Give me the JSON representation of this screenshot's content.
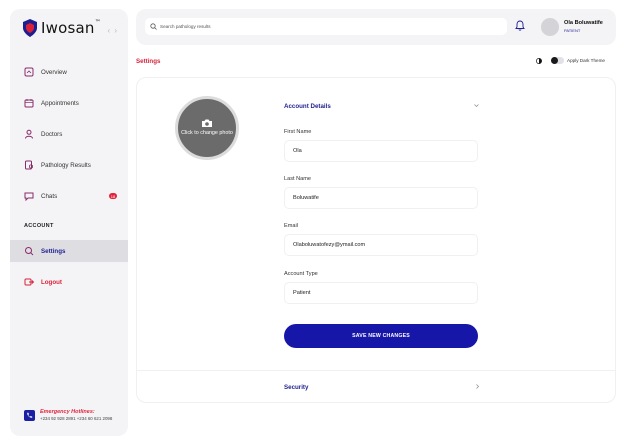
{
  "brand": {
    "name": "Iwosan",
    "tm": "™"
  },
  "sidebar": {
    "collapse_glyph": "‹ ›",
    "items": [
      {
        "label": "Overview",
        "icon": "overview-icon"
      },
      {
        "label": "Appointments",
        "icon": "calendar-icon"
      },
      {
        "label": "Doctors",
        "icon": "doctor-icon"
      },
      {
        "label": "Pathology Results",
        "icon": "pathology-icon"
      },
      {
        "label": "Chats",
        "icon": "chat-icon",
        "badge": "18"
      }
    ],
    "section_label": "ACCOUNT",
    "account_items": [
      {
        "label": "Settings",
        "icon": "settings-icon",
        "active": true
      },
      {
        "label": "Logout",
        "icon": "logout-icon"
      }
    ],
    "hotline": {
      "title": "Emergency Hotlines:",
      "numbers": "+234 92 928 2891 +234 60 621 2098"
    }
  },
  "header": {
    "search_placeholder": "Search pathology results",
    "user_name": "Ola Boluwatife",
    "user_role": "PATIENT"
  },
  "page": {
    "title": "Settings",
    "theme_label": "Apply Dark Theme"
  },
  "profile": {
    "photo_label": "Click to change photo"
  },
  "account": {
    "header": "Account Details",
    "fields": [
      {
        "label": "First Name",
        "value": "Ola"
      },
      {
        "label": "Last Name",
        "value": "Boluwatife"
      },
      {
        "label": "Email",
        "value": "Olaboluwatofezy@ymail.com"
      },
      {
        "label": "Account Type",
        "value": "Patient"
      }
    ],
    "save_label": "SAVE NEW CHANGES"
  },
  "security": {
    "header": "Security"
  },
  "colors": {
    "primary": "#1616a8",
    "accent_red": "#d9213a",
    "sidebar_bg": "#f4f4f6"
  }
}
